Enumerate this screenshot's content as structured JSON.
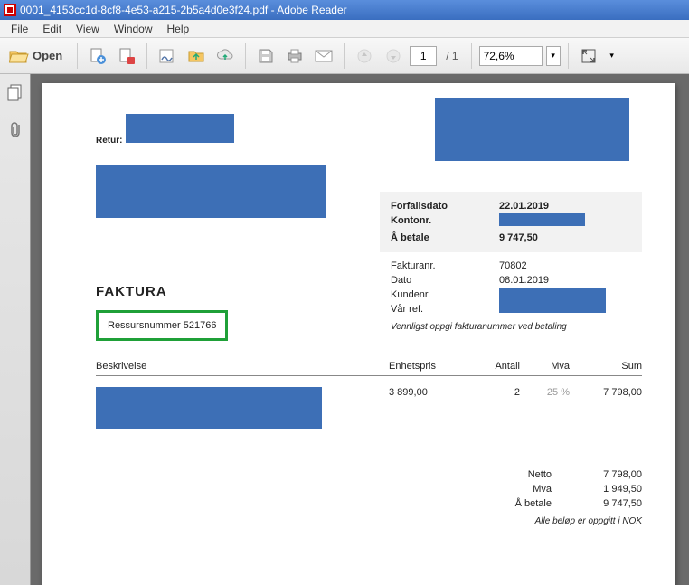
{
  "window": {
    "title": "0001_4153cc1d-8cf8-4e53-a215-2b5a4d0e3f24.pdf - Adobe Reader"
  },
  "menu": {
    "file": "File",
    "edit": "Edit",
    "view": "View",
    "window": "Window",
    "help": "Help"
  },
  "toolbar": {
    "open": "Open",
    "page_current": "1",
    "page_total": "/ 1",
    "zoom": "72,6%"
  },
  "doc": {
    "retur_label": "Retur:",
    "info": {
      "forfallsdato_label": "Forfallsdato",
      "forfallsdato": "22.01.2019",
      "kontonr_label": "Kontonr.",
      "abetale_label": "Å betale",
      "abetale": "9 747,50"
    },
    "ref": {
      "fakturanr_label": "Fakturanr.",
      "fakturanr": "70802",
      "dato_label": "Dato",
      "dato": "08.01.2019",
      "kundenr_label": "Kundenr.",
      "varref_label": "Vår ref."
    },
    "vennligst": "Vennligst oppgi fakturanummer ved betaling",
    "faktura_title": "FAKTURA",
    "ressurs": "Ressursnummer 521766",
    "table": {
      "head": {
        "beskrivelse": "Beskrivelse",
        "enhetspris": "Enhetspris",
        "antall": "Antall",
        "mva": "Mva",
        "sum": "Sum"
      },
      "row1": {
        "enhetspris": "3 899,00",
        "antall": "2",
        "mva": "25 %",
        "sum": "7 798,00"
      }
    },
    "totals": {
      "netto_label": "Netto",
      "netto": "7 798,00",
      "mva_label": "Mva",
      "mva": "1 949,50",
      "abetale_label": "Å betale",
      "abetale": "9 747,50"
    },
    "currency_note": "Alle beløp er oppgitt i NOK"
  }
}
